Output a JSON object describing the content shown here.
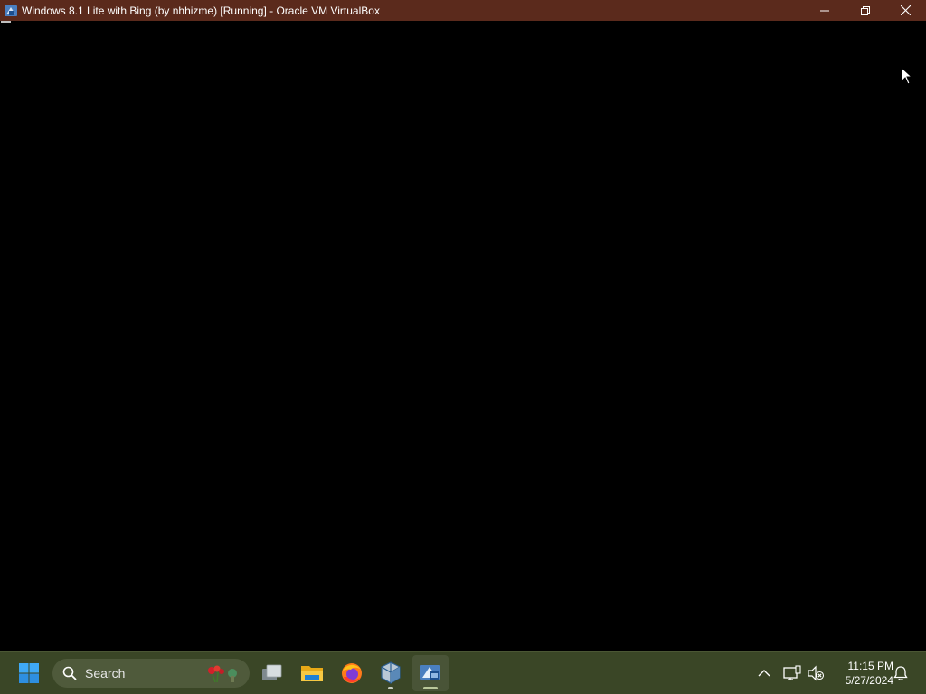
{
  "window": {
    "title": "Windows 8.1 Lite with Bing (by nhhizme) [Running] - Oracle VM VirtualBox",
    "titlebar_color": "#5b2a1c",
    "controls": {
      "minimize": "minimize",
      "restore": "restore",
      "close": "close"
    }
  },
  "vm": {
    "screen_color": "#000000",
    "text_cursor_visible": true
  },
  "taskbar": {
    "background": "#3a4626",
    "start_icon": "windows-start-icon",
    "search": {
      "label": "Search",
      "icon": "search-icon"
    },
    "pinned": [
      {
        "name": "task-view",
        "icon": "task-view-icon",
        "active": false
      },
      {
        "name": "file-explorer",
        "icon": "folder-icon",
        "active": false
      },
      {
        "name": "firefox",
        "icon": "firefox-icon",
        "active": false
      },
      {
        "name": "virtualbox-manager",
        "icon": "virtualbox-icon",
        "active": false,
        "running": true
      },
      {
        "name": "virtualbox-vm",
        "icon": "vm-window-icon",
        "active": true,
        "running": true
      }
    ],
    "tray": {
      "chevron": "show-hidden-icons",
      "network": "network-icon",
      "volume": "volume-muted-icon",
      "notifications": "notification-bell-icon"
    },
    "clock": {
      "time": "11:15 PM",
      "date": "5/27/2024"
    }
  }
}
